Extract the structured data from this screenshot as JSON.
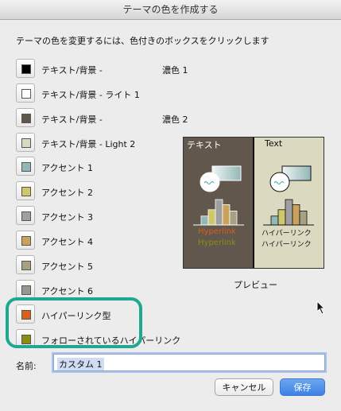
{
  "window": {
    "title": "テーマの色を作成する"
  },
  "instruction": "テーマの色を変更するには、色付きのボックスをクリックします",
  "color_rows": [
    {
      "label": "テキスト/背景 -",
      "sub": "濃色 1",
      "color": "#000000"
    },
    {
      "label": "テキスト/背景 - ライト 1",
      "sub": "",
      "color": "#ffffff"
    },
    {
      "label": "テキスト/背景 -",
      "sub": "濃色 2",
      "color": "#5f574b"
    },
    {
      "label": "テキスト/背景 - Light 2",
      "sub": "",
      "color": "#dcd9c1"
    },
    {
      "label": "アクセント 1",
      "sub": "",
      "color": "#93b6b6"
    },
    {
      "label": "アクセント 2",
      "sub": "",
      "color": "#cfc86a"
    },
    {
      "label": "アクセント 3",
      "sub": "",
      "color": "#9f9f9f"
    },
    {
      "label": "アクセント 4",
      "sub": "",
      "color": "#c9a25d"
    },
    {
      "label": "アクセント 5",
      "sub": "",
      "color": "#a8a082"
    },
    {
      "label": "アクセント 6",
      "sub": "",
      "color": "#93998f"
    },
    {
      "label": "ハイパーリンク型",
      "sub": "",
      "color": "#d95f1a"
    },
    {
      "label": "フォローされているハイパーリンク",
      "sub": "",
      "color": "#8a8f12"
    }
  ],
  "preview": {
    "dark_title": "テキスト",
    "light_title": "Text",
    "dark_link": "Hyperlink",
    "dark_followed": "Hyperlink",
    "light_link": "ハイパーリンク",
    "light_followed": "ハイパーリンク",
    "caption": "プレビュー",
    "bar_heights": [
      0.35,
      0.6,
      1.0,
      0.8,
      0.55
    ],
    "bar_colors": [
      "#93b6b6",
      "#cfc86a",
      "#9f9f9f",
      "#c9a25d",
      "#a8a082"
    ],
    "link_color": "#d95f1a",
    "followed_color": "#8a8f12"
  },
  "name_field": {
    "label": "名前:",
    "value": "カスタム 1"
  },
  "buttons": {
    "cancel": "キャンセル",
    "save": "保存"
  }
}
